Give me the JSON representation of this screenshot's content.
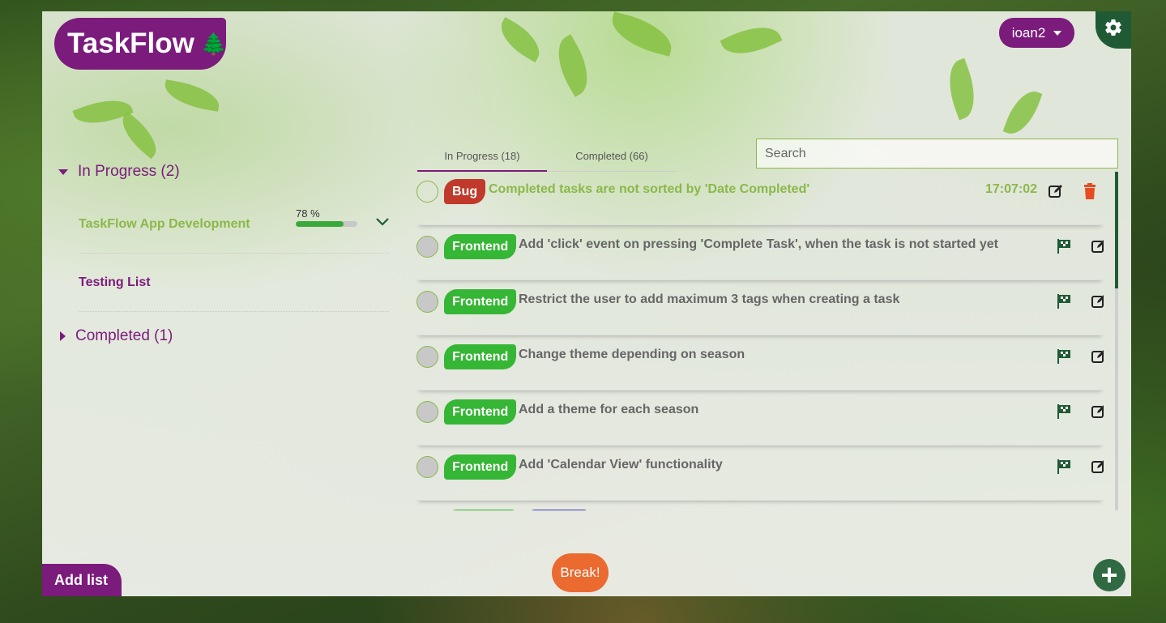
{
  "app": {
    "title": "TaskFlow",
    "logo_glyph": "🌲"
  },
  "header": {
    "user_label": "ioan2",
    "settings_icon": "gear-icon"
  },
  "sidebar": {
    "in_progress_label": "In Progress (2)",
    "completed_label": "Completed (1)",
    "lists": [
      {
        "label": "TaskFlow App Development",
        "progress_label": "78 %",
        "progress": 0.78,
        "color": "#8bb84a"
      },
      {
        "label": "Testing List",
        "color": "#7b1b7c"
      }
    ]
  },
  "tabs": [
    {
      "label": "In Progress (18)"
    },
    {
      "label": "Completed (66)"
    }
  ],
  "search": {
    "placeholder": "Search"
  },
  "tasks": [
    {
      "tag": "Bug",
      "title": "Completed tasks are not sorted by 'Date Completed'",
      "time": "17:07:02",
      "active": true
    },
    {
      "tag": "Frontend",
      "title": "Add 'click' event on pressing 'Complete Task', when the task is not started yet"
    },
    {
      "tag": "Frontend",
      "title": "Restrict the user to add maximum 3 tags when creating a task"
    },
    {
      "tag": "Frontend",
      "title": "Change theme depending on season"
    },
    {
      "tag": "Frontend",
      "title": "Add a theme for each season"
    },
    {
      "tag": "Frontend",
      "title": "Add 'Calendar View' functionality"
    }
  ],
  "footer": {
    "add_list": "Add list",
    "break_label": "Break!",
    "add_icon": "plus-icon"
  },
  "colors": {
    "accent": "#7b1b7c",
    "green": "#8bb84a",
    "bug": "#c0392b",
    "frontend": "#35b635",
    "danger": "#ea4a1f",
    "dark_green": "#1f5a35"
  }
}
